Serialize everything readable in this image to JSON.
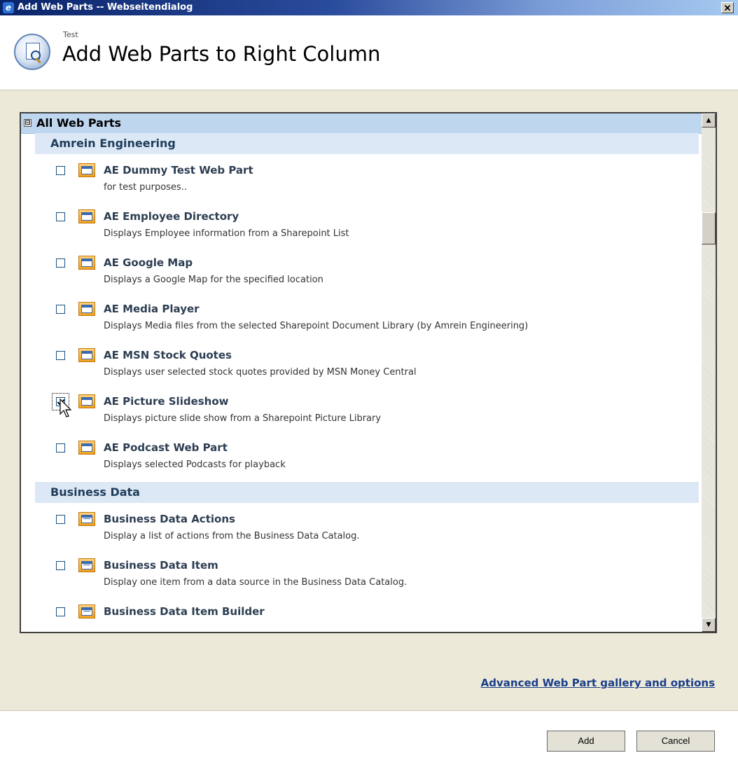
{
  "window": {
    "title": "Add Web Parts -- Webseitendialog",
    "close_glyph": "✕"
  },
  "header": {
    "breadcrumb": "Test",
    "page_title": "Add Web Parts to Right Column"
  },
  "list": {
    "all_label": "All Web Parts",
    "collapse_glyph": "⊟",
    "categories": [
      {
        "label": "Amrein Engineering",
        "items": [
          {
            "name": "AE Dummy Test Web Part",
            "desc": "for test purposes..",
            "checked": false,
            "icon": "webpart-icon"
          },
          {
            "name": "AE Employee Directory",
            "desc": "Displays Employee information from a Sharepoint List",
            "checked": false,
            "icon": "webpart-icon"
          },
          {
            "name": "AE Google Map",
            "desc": "Displays a Google Map for the specified location",
            "checked": false,
            "icon": "webpart-icon"
          },
          {
            "name": "AE Media Player",
            "desc": "Displays Media files from the selected Sharepoint Document Library (by Amrein Engineering)",
            "checked": false,
            "icon": "webpart-icon"
          },
          {
            "name": "AE MSN Stock Quotes",
            "desc": "Displays user selected stock quotes provided by MSN Money Central",
            "checked": false,
            "icon": "webpart-icon"
          },
          {
            "name": "AE Picture Slideshow",
            "desc": "Displays picture slide show from a Sharepoint Picture Library",
            "checked": true,
            "icon": "webpart-icon"
          },
          {
            "name": "AE Podcast Web Part",
            "desc": "Displays selected Podcasts for playback",
            "checked": false,
            "icon": "webpart-icon"
          }
        ]
      },
      {
        "label": "Business Data",
        "items": [
          {
            "name": "Business Data Actions",
            "desc": "Display a list of actions from the Business Data Catalog.",
            "checked": false,
            "icon": "list-webpart-icon"
          },
          {
            "name": "Business Data Item",
            "desc": "Display one item from a data source in the Business Data Catalog.",
            "checked": false,
            "icon": "list-webpart-icon"
          },
          {
            "name": "Business Data Item Builder",
            "desc": "",
            "checked": false,
            "icon": "list-webpart-icon"
          }
        ]
      }
    ],
    "scroll_up_glyph": "▲",
    "scroll_down_glyph": "▼"
  },
  "links": {
    "gallery": "Advanced Web Part gallery and options"
  },
  "footer": {
    "add_label": "Add",
    "cancel_label": "Cancel"
  },
  "colors": {
    "title_bar": "#0a246a",
    "dialog_bg": "#ece9d8",
    "group_header": "#bfd6ef",
    "category_header": "#dce8f6",
    "link": "#1a3f8a"
  }
}
